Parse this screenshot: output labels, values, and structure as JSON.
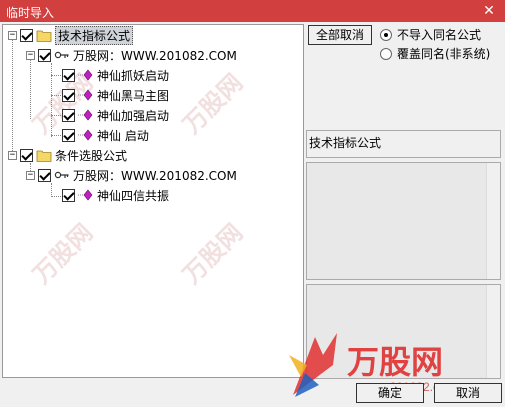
{
  "window": {
    "title": "临时导入",
    "close_glyph": "✕"
  },
  "tree": {
    "nodes": [
      {
        "id": "n1",
        "label": "技术指标公式",
        "expander": "−",
        "checked": true,
        "icon": "folder-icon"
      },
      {
        "id": "n2",
        "label": "万股网：WWW.201082.COM",
        "expander": "−",
        "checked": true,
        "icon": "key-icon"
      },
      {
        "id": "n3",
        "label": "神仙抓妖启动",
        "checked": true,
        "icon": "formula-diamond-icon"
      },
      {
        "id": "n4",
        "label": "神仙黑马主图",
        "checked": true,
        "icon": "formula-diamond-icon"
      },
      {
        "id": "n5",
        "label": "神仙加强启动",
        "checked": true,
        "icon": "formula-diamond-icon"
      },
      {
        "id": "n6",
        "label": "神仙 启动",
        "checked": true,
        "icon": "formula-diamond-icon"
      },
      {
        "id": "n7",
        "label": "条件选股公式",
        "expander": "−",
        "checked": true,
        "icon": "folder-icon"
      },
      {
        "id": "n8",
        "label": "万股网：WWW.201082.COM",
        "expander": "−",
        "checked": true,
        "icon": "key-icon"
      },
      {
        "id": "n9",
        "label": "神仙四信共振",
        "checked": true,
        "icon": "formula-diamond-icon"
      }
    ]
  },
  "controls": {
    "cancel_all_label": "全部取消",
    "radio_skip_label": "不导入同名公式",
    "radio_overwrite_label": "覆盖同名(非系统)",
    "selected_option": "skip"
  },
  "details": {
    "section_label": "技术指标公式"
  },
  "footer": {
    "ok_label": "确定",
    "cancel_label": "取消"
  },
  "branding": {
    "logo_text": "万股网",
    "logo_url_text": "www.201082.com"
  },
  "colors": {
    "titlebar": "#d23f3f",
    "folder": "#f5d768",
    "diamond": "#c020c0",
    "logo_red": "#e03030"
  }
}
